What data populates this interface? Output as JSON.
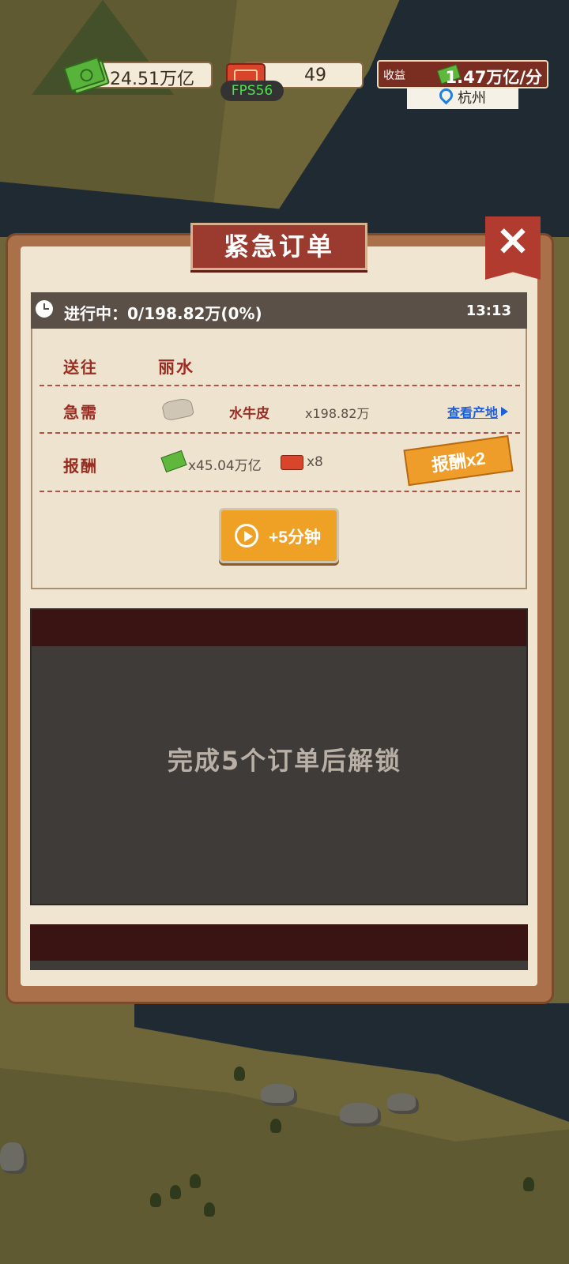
{
  "hud": {
    "cash": "24.51万亿",
    "tickets": "49",
    "fps": "FPS56",
    "income_label": "收益",
    "income_value": "1.47万亿/分",
    "city": "杭州"
  },
  "modal": {
    "title": "紧急订单",
    "progress": "进行中：0/198.82万(0%)",
    "timer": "13:13",
    "deliver_label": "送往",
    "destination": "丽水",
    "need_label": "急需",
    "material_name": "水牛皮",
    "material_qty": "x198.82万",
    "origin_link": "查看产地",
    "reward_label": "报酬",
    "reward_cash": "x45.04万亿",
    "reward_tickets": "x8",
    "double_reward": "报酬x2",
    "ad_button": "+5分钟",
    "locked_text": "完成5个订单后解锁"
  },
  "icons": {
    "cash": "cash-icon",
    "ticket": "ticket-icon",
    "location": "pin-icon",
    "clock": "clock-icon",
    "close": "close-icon",
    "play": "play-icon",
    "leather": "leather-icon"
  },
  "colors": {
    "accent_red": "#9b3a2e",
    "link_blue": "#1f5fd6",
    "button_orange": "#efa126",
    "fps_green": "#4ee04e"
  }
}
